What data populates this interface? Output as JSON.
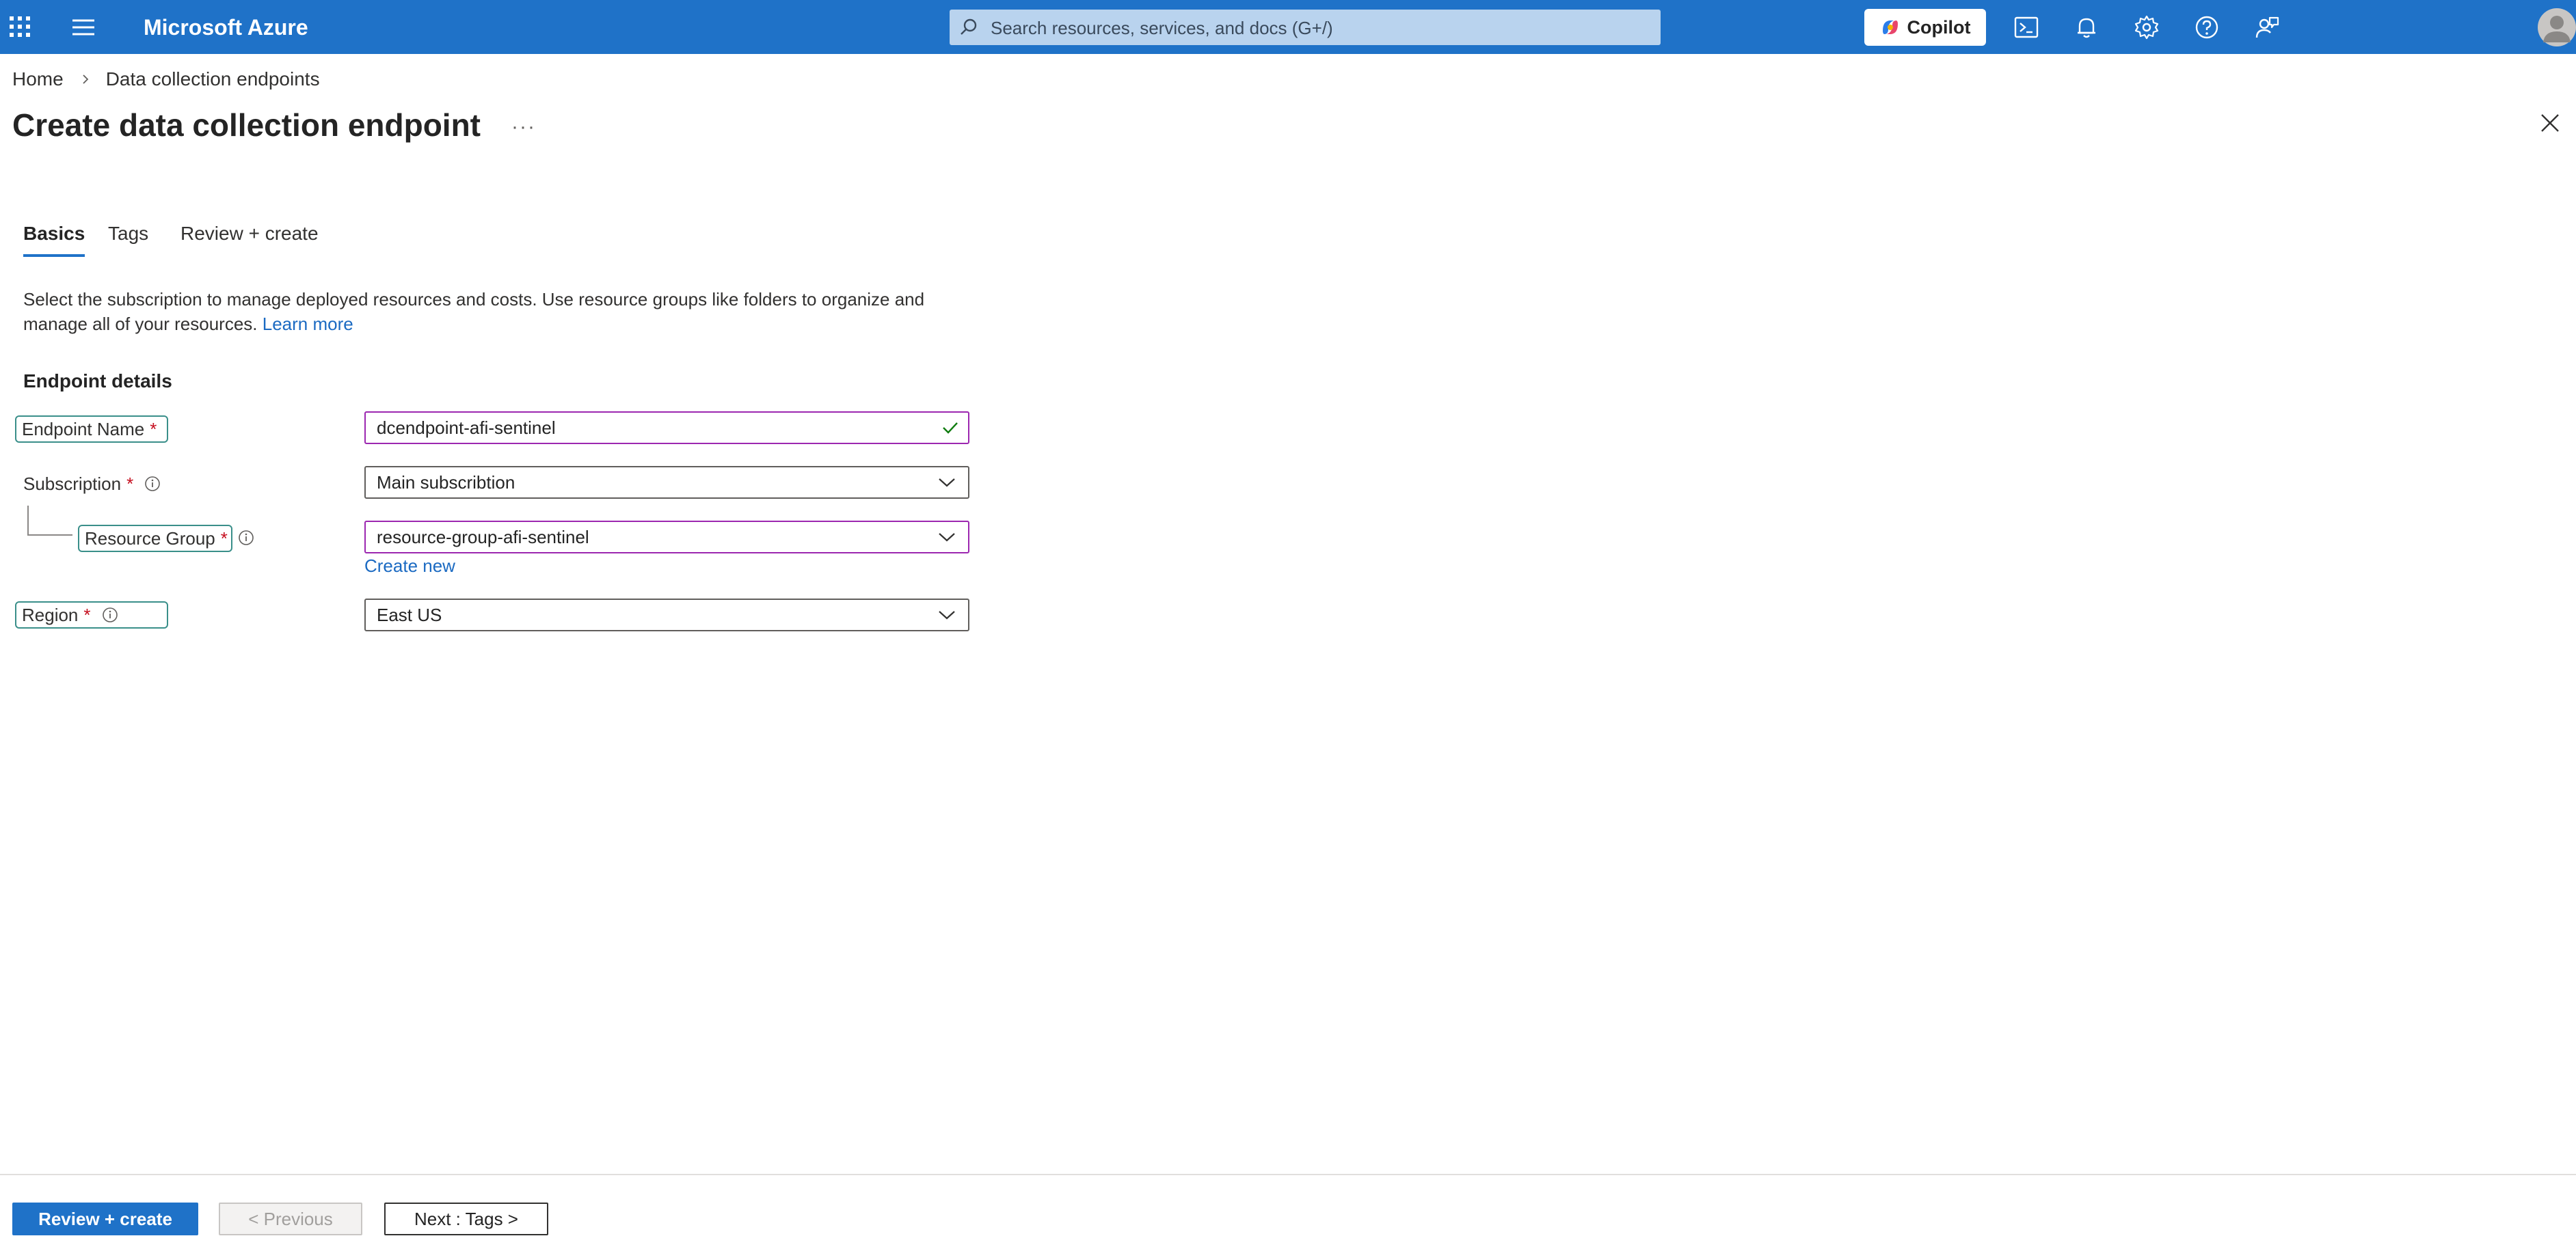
{
  "app": {
    "brand": "Microsoft Azure",
    "search_placeholder": "Search resources, services, and docs (G+/)",
    "copilot_label": "Copilot"
  },
  "breadcrumb": {
    "items": [
      "Home",
      "Data collection endpoints"
    ]
  },
  "page": {
    "title": "Create data collection endpoint",
    "more_label": "···"
  },
  "tabs": [
    {
      "label": "Basics",
      "active": true
    },
    {
      "label": "Tags",
      "active": false
    },
    {
      "label": "Review + create",
      "active": false
    }
  ],
  "description": {
    "text": "Select the subscription to manage deployed resources and costs. Use resource groups like folders to organize and manage all of your resources.",
    "link": "Learn more"
  },
  "form": {
    "section_title": "Endpoint details",
    "required_mark": "*",
    "endpoint_name": {
      "label": "Endpoint Name",
      "value": "dcendpoint-afi-sentinel"
    },
    "subscription": {
      "label": "Subscription",
      "value": "Main subscribtion"
    },
    "resource_group": {
      "label": "Resource Group",
      "value": "resource-group-afi-sentinel",
      "create_new": "Create new"
    },
    "region": {
      "label": "Region",
      "value": "East US"
    }
  },
  "footer": {
    "review_create": "Review + create",
    "previous": "< Previous",
    "next": "Next : Tags >"
  },
  "colors": {
    "topbar": "#1f72c8",
    "link": "#1b6ac2",
    "focus_border": "#9c27b0",
    "label_outline": "#3a8f8a",
    "required": "#c50f1f"
  }
}
